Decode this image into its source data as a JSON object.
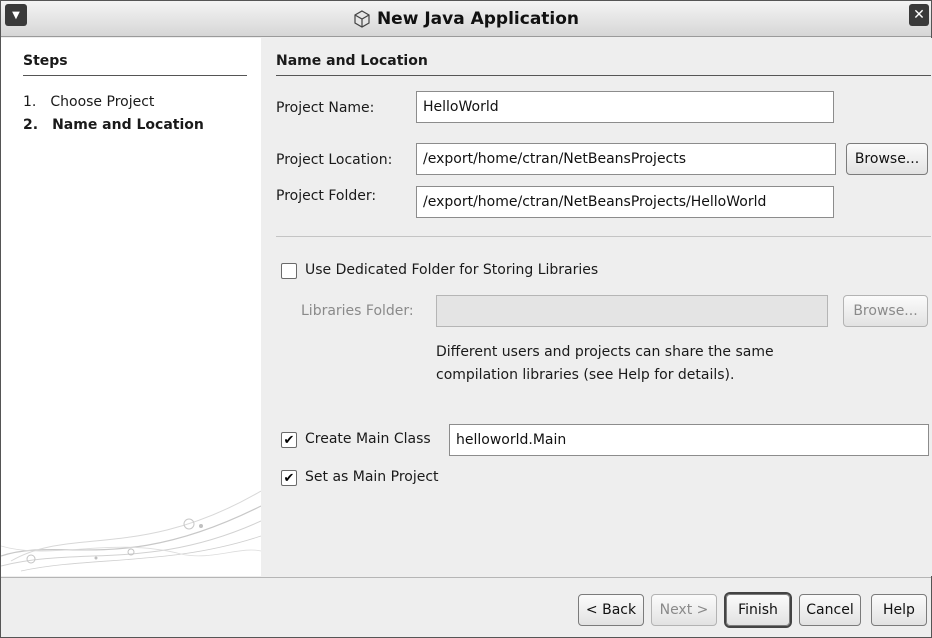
{
  "window": {
    "title": "New Java Application"
  },
  "steps": {
    "title": "Steps",
    "items": [
      {
        "number": "1.",
        "label": "Choose Project"
      },
      {
        "number": "2.",
        "label": "Name and Location"
      }
    ]
  },
  "panel": {
    "title": "Name and Location",
    "project_name_label": "Project Name:",
    "project_name_value": "HelloWorld",
    "project_location_label": "Project Location:",
    "project_location_value": "/export/home/ctran/NetBeansProjects",
    "project_folder_label": "Project Folder:",
    "project_folder_value": "/export/home/ctran/NetBeansProjects/HelloWorld",
    "browse_label": "Browse...",
    "dedicated_folder_label": "Use Dedicated Folder for Storing Libraries",
    "dedicated_folder_checked": false,
    "libraries_folder_label": "Libraries Folder:",
    "libraries_folder_value": "",
    "libraries_browse_label": "Browse...",
    "help_line1": "Different users and projects can share the same",
    "help_line2": "compilation libraries (see Help for details).",
    "create_main_class_label": "Create Main Class",
    "create_main_class_checked": true,
    "main_class_value": "helloworld.Main",
    "set_main_project_label": "Set as Main Project",
    "set_main_project_checked": true
  },
  "buttons": {
    "back": "< Back",
    "next": "Next >",
    "finish": "Finish",
    "cancel": "Cancel",
    "help": "Help"
  }
}
